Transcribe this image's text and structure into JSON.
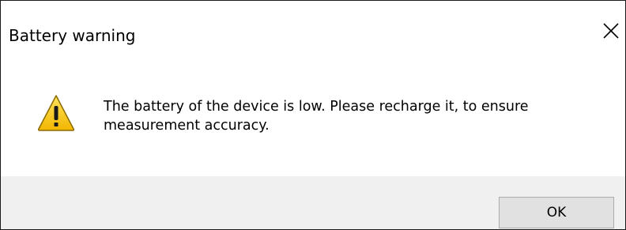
{
  "dialog": {
    "title": "Battery warning",
    "close_icon": "close-icon",
    "warning_icon": "warning-icon",
    "message": "The battery of the device is low. Please recharge it, to ensure measurement accuracy.",
    "ok_label": "OK"
  },
  "colors": {
    "footer_background": "#f0f0f0",
    "button_background": "#e1e1e1",
    "warning_yellow": "#f5c400"
  }
}
